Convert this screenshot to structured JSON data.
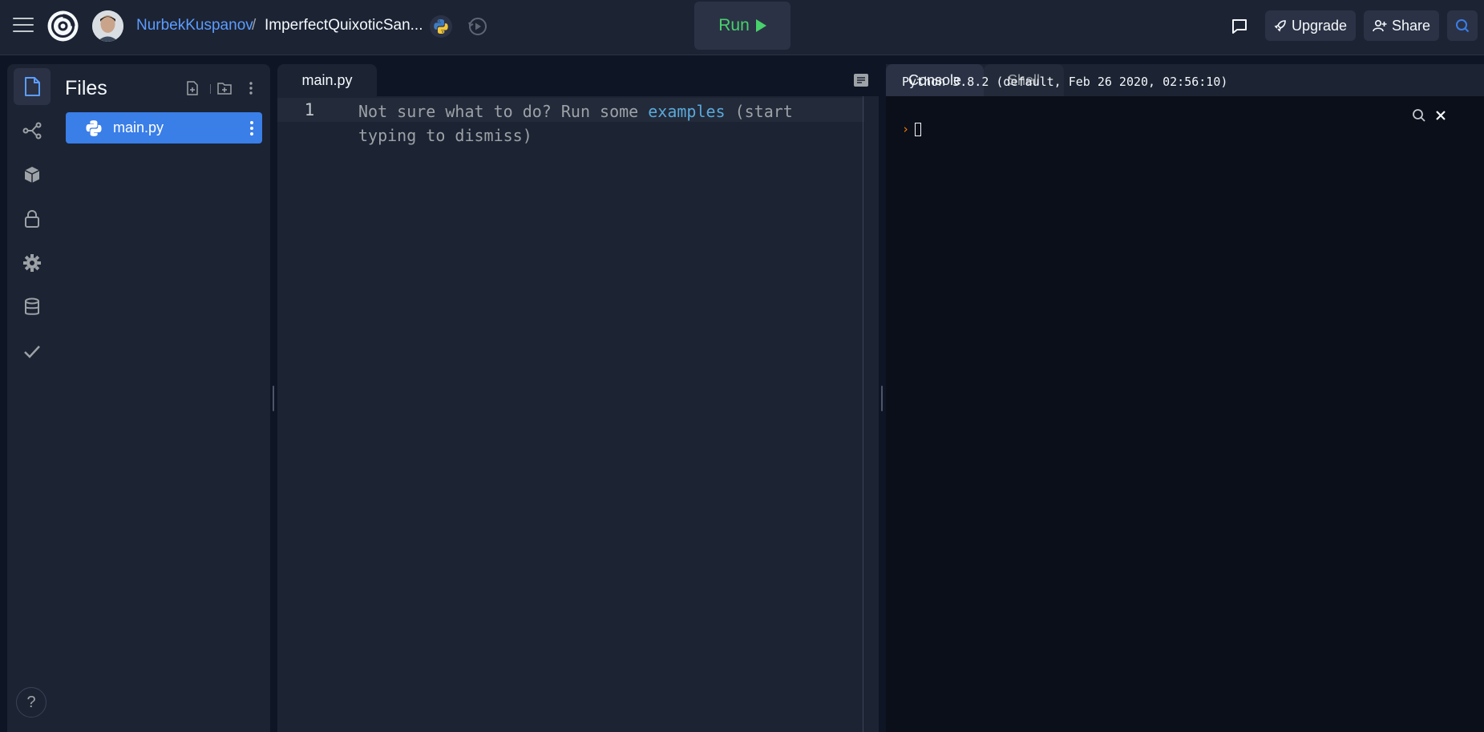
{
  "header": {
    "username": "NurbekKuspanov",
    "separator": "/",
    "repl_name": "ImperfectQuixoticSan...",
    "run_label": "Run",
    "upgrade_label": "Upgrade",
    "share_label": "Share"
  },
  "sidebar": {
    "items": [
      {
        "icon": "file-icon",
        "active": true
      },
      {
        "icon": "git-icon",
        "active": false
      },
      {
        "icon": "package-icon",
        "active": false
      },
      {
        "icon": "lock-icon",
        "active": false
      },
      {
        "icon": "gear-icon",
        "active": false
      },
      {
        "icon": "database-icon",
        "active": false
      },
      {
        "icon": "check-icon",
        "active": false
      }
    ],
    "help_label": "?"
  },
  "files": {
    "title": "Files",
    "items": [
      {
        "name": "main.py",
        "selected": true
      }
    ]
  },
  "editor": {
    "tab_label": "main.py",
    "line_number": "1",
    "placeholder_before": "Not sure what to do? Run some ",
    "placeholder_link": "examples",
    "placeholder_after": " (start typing to dismiss)"
  },
  "console": {
    "tabs": [
      "Console",
      "Shell"
    ],
    "active_tab": "Console",
    "banner": "Python 3.8.2 (default, Feb 26 2020, 02:56:10)",
    "prompt": "›"
  },
  "colors": {
    "accent": "#3a7ee8",
    "run": "#48d16c",
    "username": "#5c9dff",
    "prompt": "#f57a00"
  }
}
